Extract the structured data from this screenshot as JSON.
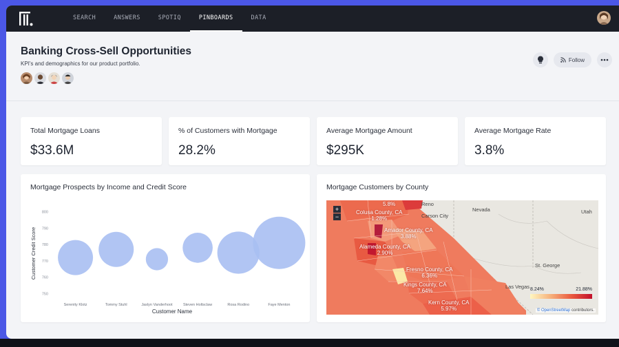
{
  "nav": {
    "items": [
      {
        "label": "SEARCH",
        "active": false
      },
      {
        "label": "ANSWERS",
        "active": false
      },
      {
        "label": "SPOTIQ",
        "active": false
      },
      {
        "label": "PINBOARDS",
        "active": true
      },
      {
        "label": "DATA",
        "active": false
      }
    ],
    "logo_icon": "thoughtspot-logo-icon",
    "avatar_icon": "user-avatar"
  },
  "header": {
    "title": "Banking Cross-Sell Opportunities",
    "subtitle": "KPI's and demographics for our product portfolio.",
    "follow_label": "Follow"
  },
  "kpis": [
    {
      "label": "Total Mortgage Loans",
      "value": "$33.6M"
    },
    {
      "label": "% of Customers with Mortgage",
      "value": "28.2%"
    },
    {
      "label": "Average Mortgage Amount",
      "value": "$295K"
    },
    {
      "label": "Average Mortgage Rate",
      "value": "3.8%"
    }
  ],
  "bubble_chart": {
    "title": "Mortgage Prospects by Income and Credit Score",
    "xlabel": "Customer Name",
    "ylabel": "Customer Credit Score",
    "color": "#a9bff2"
  },
  "chart_data": {
    "type": "scatter",
    "title": "Mortgage Prospects by Income and Credit Score",
    "xlabel": "Customer Name",
    "ylabel": "Customer Credit Score",
    "categories": [
      "Serenity Klotz",
      "Tommy Stuhl",
      "Jaslyn Vanderhoot",
      "Steven Holtsclaw",
      "Rosa Rodino",
      "Faye Menton"
    ],
    "y": [
      772,
      777,
      771,
      778,
      775,
      781
    ],
    "size": [
      0.45,
      0.45,
      0.18,
      0.33,
      0.65,
      1.0
    ],
    "yticks": [
      750,
      760,
      770,
      780,
      790,
      800
    ],
    "ylim": [
      748,
      802
    ],
    "grid": false
  },
  "map": {
    "title": "Mortgage Customers by County",
    "legend_min": "8.24%",
    "legend_max": "21.88%",
    "attribution_link": "© OpenStreetMap",
    "attribution_rest": " contributors.",
    "zoom_in": "+",
    "zoom_out": "−",
    "county_labels": [
      {
        "text": "5.8%"
      },
      {
        "text": "Colusa County, CA\n1.28%"
      },
      {
        "text": "Amador County, CA\n3.88%"
      },
      {
        "text": "Alameda County, CA\n2.90%"
      },
      {
        "text": "Fresno County, CA\n6.36%"
      },
      {
        "text": "Kings County, CA\n7.64%"
      },
      {
        "text": "Kern County, CA\n5.97%"
      }
    ],
    "city_labels": [
      "Reno",
      "Carson City",
      "Nevada",
      "Utah",
      "St. George",
      "Las Vegas"
    ]
  }
}
